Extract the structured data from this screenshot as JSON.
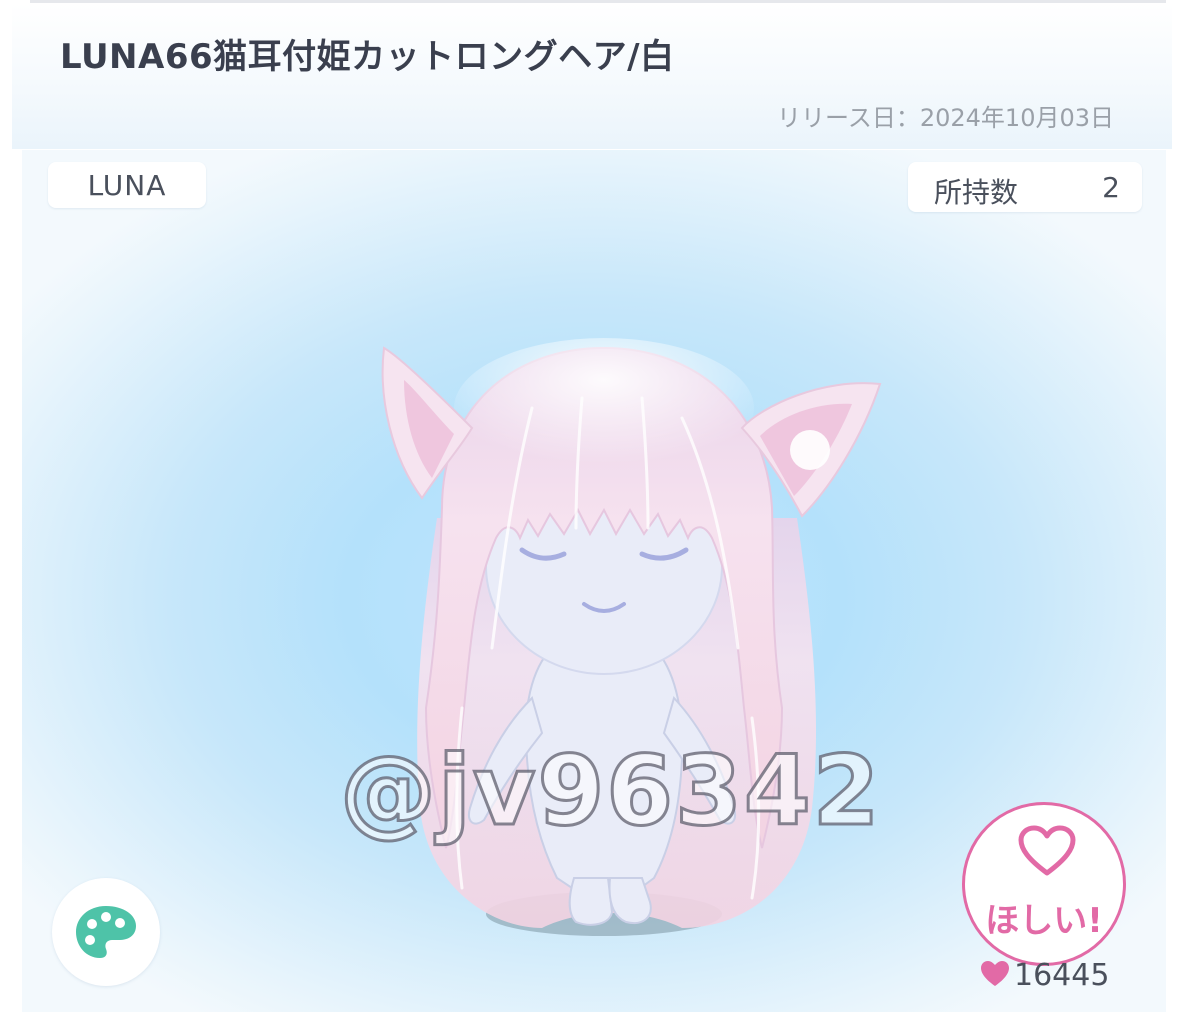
{
  "header": {
    "title": "LUNA66猫耳付姫カットロングヘア/白",
    "release_label": "リリース日",
    "release_sep": "：",
    "release_date": "2024年10月03日"
  },
  "item": {
    "brand": "LUNA",
    "owned_label": "所持数",
    "owned_count": "2"
  },
  "actions": {
    "want_label": "ほしい!",
    "like_count": "16445"
  },
  "watermark": {
    "text": "@jv96342"
  },
  "icons": {
    "heart": "heart-outline-icon",
    "like": "heart-filled-icon",
    "palette": "palette-icon"
  },
  "colors": {
    "accent_pink": "#e26aa6",
    "palette_teal": "#4ec3a8",
    "title_text": "#3a3f4e",
    "muted_text": "#9aa0a8",
    "stage_blue": "#b4e1fb"
  }
}
